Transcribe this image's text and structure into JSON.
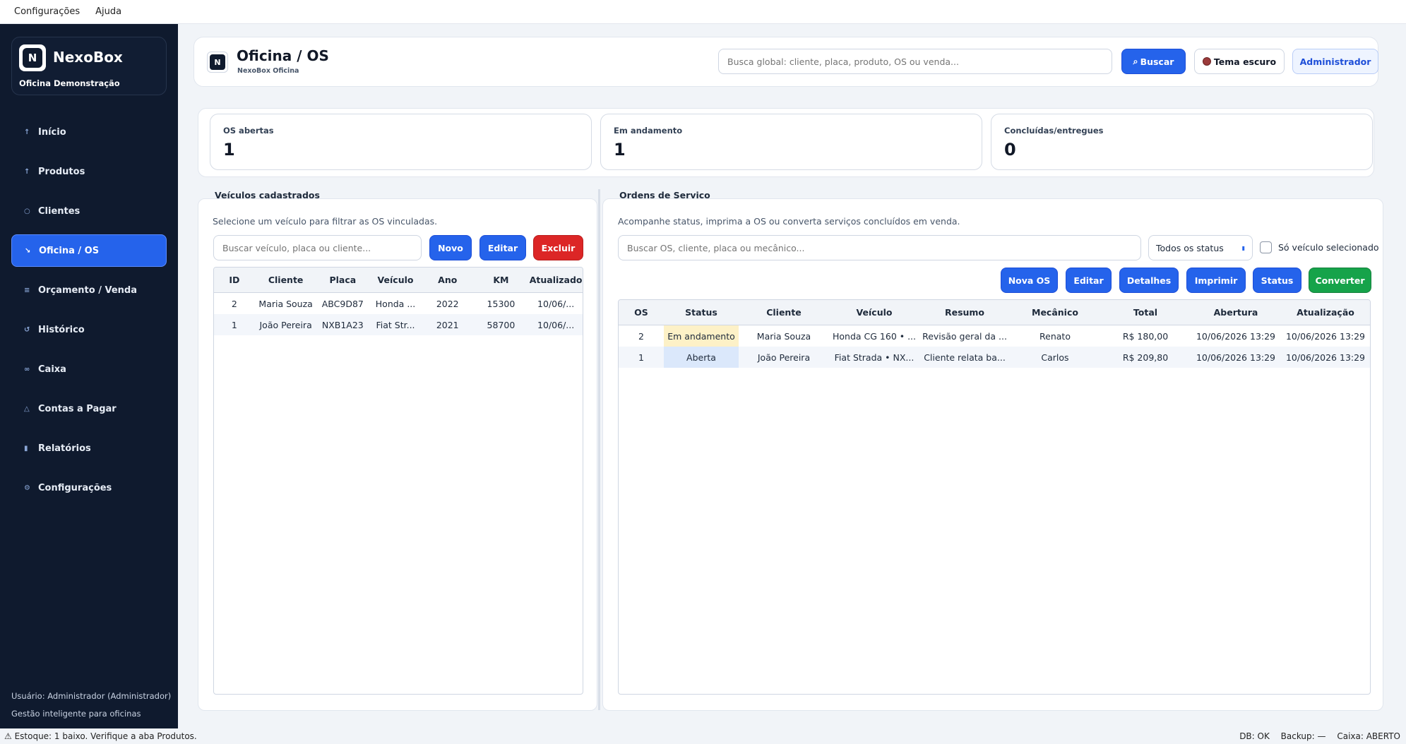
{
  "menubar": {
    "items": [
      "Configurações",
      "Ajuda"
    ]
  },
  "sidebar": {
    "brand_initial": "N",
    "brand_name": "NexoBox",
    "brand_sub": "Oficina Demonstração",
    "items": [
      {
        "label": "Início",
        "icon": "↑"
      },
      {
        "label": "Produtos",
        "icon": "↑"
      },
      {
        "label": "Clientes",
        "icon": "○"
      },
      {
        "label": "Oficina / OS",
        "icon": "↘"
      },
      {
        "label": "Orçamento / Venda",
        "icon": "≡"
      },
      {
        "label": "Histórico",
        "icon": "↺"
      },
      {
        "label": "Caixa",
        "icon": "∞"
      },
      {
        "label": "Contas a Pagar",
        "icon": "△"
      },
      {
        "label": "Relatórios",
        "icon": "▮"
      },
      {
        "label": "Configurações",
        "icon": "⚙"
      }
    ],
    "footer_user": "Usuário: Administrador (Administrador)",
    "footer_tagline": "Gestão inteligente para oficinas"
  },
  "header": {
    "title": "Oficina / OS",
    "subtitle": "NexoBox Oficina",
    "search_placeholder": "Busca global: cliente, placa, produto, OS ou venda...",
    "search_button": "Buscar",
    "theme_button": "Tema escuro",
    "admin_button": "Administrador"
  },
  "stats": [
    {
      "label": "OS abertas",
      "value": "1"
    },
    {
      "label": "Em andamento",
      "value": "1"
    },
    {
      "label": "Concluídas/entregues",
      "value": "0"
    }
  ],
  "vehicles": {
    "title": "Veículos cadastrados",
    "description": "Selecione um veículo para filtrar as OS vinculadas.",
    "search_placeholder": "Buscar veículo, placa ou cliente...",
    "btn_new": "Novo",
    "btn_edit": "Editar",
    "btn_delete": "Excluir",
    "columns": [
      "ID",
      "Cliente",
      "Placa",
      "Veículo",
      "Ano",
      "KM",
      "Atualizado"
    ],
    "rows": [
      [
        "2",
        "Maria Souza",
        "ABC9D87",
        "Honda ...",
        "2022",
        "15300",
        "10/06/..."
      ],
      [
        "1",
        "João Pereira",
        "NXB1A23",
        "Fiat Str...",
        "2021",
        "58700",
        "10/06/..."
      ]
    ]
  },
  "orders": {
    "title": "Ordens de Serviço",
    "description": "Acompanhe status, imprima a OS ou converta serviços concluídos em venda.",
    "search_placeholder": "Buscar OS, cliente, placa ou mecânico...",
    "status_filter": "Todos os status",
    "only_selected_label": "Só veículo selecionado",
    "btn_new": "Nova OS",
    "btn_edit": "Editar",
    "btn_details": "Detalhes",
    "btn_print": "Imprimir",
    "btn_status": "Status",
    "btn_convert": "Converter",
    "columns": [
      "OS",
      "Status",
      "Cliente",
      "Veículo",
      "Resumo",
      "Mecânico",
      "Total",
      "Abertura",
      "Atualização"
    ],
    "rows": [
      [
        "2",
        "Em andamento",
        "Maria Souza",
        "Honda CG 160 • ...",
        "Revisão geral da ...",
        "Renato",
        "R$ 180,00",
        "10/06/2026 13:29",
        "10/06/2026 13:29"
      ],
      [
        "1",
        "Aberta",
        "João Pereira",
        "Fiat Strada • NX...",
        "Cliente relata ba...",
        "Carlos",
        "R$ 209,80",
        "10/06/2026 13:29",
        "10/06/2026 13:29"
      ]
    ]
  },
  "statusbar": {
    "left": "⚠ Estoque: 1 baixo. Verifique a aba Produtos.",
    "db": "DB: OK",
    "backup": "Backup: —",
    "caixa": "Caixa: ABERTO"
  },
  "colors": {
    "sidebar_bg": "#0f1a2e",
    "accent": "#2563eb",
    "danger": "#dc2626",
    "success": "#16a34a",
    "status_in_progress": "#fdf1c7",
    "status_open": "#dbe8fb"
  }
}
